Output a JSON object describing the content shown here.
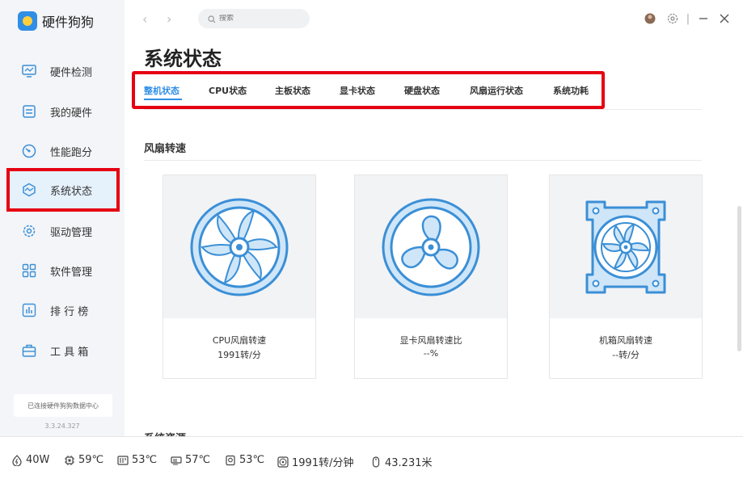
{
  "app": {
    "name": "硬件狗狗",
    "version": "3.3.24.327",
    "connection_status": "已连接硬件狗狗数据中心"
  },
  "sidebar": {
    "items": [
      {
        "label": "硬件检测",
        "icon": "monitor-icon"
      },
      {
        "label": "我的硬件",
        "icon": "hardware-icon"
      },
      {
        "label": "性能跑分",
        "icon": "gauge-icon"
      },
      {
        "label": "系统状态",
        "icon": "system-status-icon",
        "active": true
      },
      {
        "label": "驱动管理",
        "icon": "gear-icon"
      },
      {
        "label": "软件管理",
        "icon": "apps-icon"
      },
      {
        "label": "排 行 榜",
        "icon": "ranking-icon"
      },
      {
        "label": "工 具 箱",
        "icon": "toolbox-icon"
      }
    ]
  },
  "topbar": {
    "search_placeholder": "搜索"
  },
  "page": {
    "title": "系统状态"
  },
  "tabs": [
    {
      "label": "整机状态",
      "active": true
    },
    {
      "label": "CPU状态"
    },
    {
      "label": "主板状态"
    },
    {
      "label": "显卡状态"
    },
    {
      "label": "硬盘状态"
    },
    {
      "label": "风扇运行状态"
    },
    {
      "label": "系统功耗"
    }
  ],
  "fan_section": {
    "title": "风扇转速",
    "cards": [
      {
        "name": "CPU风扇转速",
        "value": "1991转/分",
        "icon": "cpu-fan-icon"
      },
      {
        "name": "显卡风扇转速比",
        "value": "--%",
        "icon": "gpu-fan-icon"
      },
      {
        "name": "机箱风扇转速",
        "value": "--转/分",
        "icon": "case-fan-icon"
      }
    ]
  },
  "resource_section": {
    "title": "系统资源"
  },
  "statusbar": {
    "power": "40W",
    "cpu_temp": "59℃",
    "board_temp": "53℃",
    "gpu_temp": "57℃",
    "disk_temp": "53℃",
    "fan_speed": "1991转/分钟",
    "mouse_distance": "43.231米"
  },
  "colors": {
    "accent": "#2f8ee6",
    "highlight": "#e60012",
    "fan_fill": "#cfe6f8",
    "fan_stroke": "#3b8fd6"
  }
}
